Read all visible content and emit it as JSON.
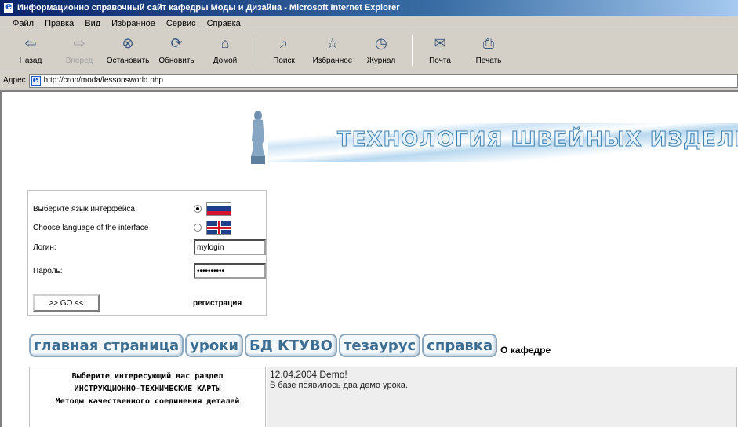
{
  "window": {
    "title": "Информационно справочный сайт кафедры Моды и Дизайна - Microsoft Internet Explorer"
  },
  "menu": [
    "Файл",
    "Правка",
    "Вид",
    "Избранное",
    "Сервис",
    "Справка"
  ],
  "toolbar": {
    "back": "Назад",
    "forward": "Вперед",
    "stop": "Остановить",
    "refresh": "Обновить",
    "home": "Домой",
    "search": "Поиск",
    "favorites": "Избранное",
    "history": "Журнал",
    "mail": "Почта",
    "print": "Печать"
  },
  "address": {
    "label": "Адрес",
    "url": "http://cron/moda/lessonsworld.php"
  },
  "banner": {
    "title": "ТЕХНОЛОГИЯ ШВЕЙНЫХ ИЗДЕЛИЙ"
  },
  "login": {
    "lang_ru_label": "Выберите язык интерфейса",
    "lang_en_label": "Choose language of the interface",
    "login_label": "Логин:",
    "login_value": "mylogin",
    "password_label": "Пароль:",
    "password_value": "••••••••••",
    "go_label": ">> GO <<",
    "register_label": "регистрация",
    "selected_lang": "ru"
  },
  "nav": {
    "home": "главная страница",
    "lessons": "уроки",
    "db": "БД КТУВО",
    "thesaurus": "тезаурус",
    "help": "справка",
    "about": "О кафедре"
  },
  "left_panel": {
    "line1": "Выберите интересующий вас раздел",
    "line2": "ИНСТРУКЦИОННО-ТЕХНИЧЕСКИЕ КАРТЫ",
    "line3": "Методы качественного соединения деталей"
  },
  "news": {
    "date": "12.04.2004 Demo!",
    "text": "В базе появилось два демо урока."
  },
  "colors": {
    "titlebar": "#0a246a",
    "nav_text": "#3c6e93",
    "flag_red": "#cf142b",
    "flag_blue": "#1d3f8a"
  }
}
